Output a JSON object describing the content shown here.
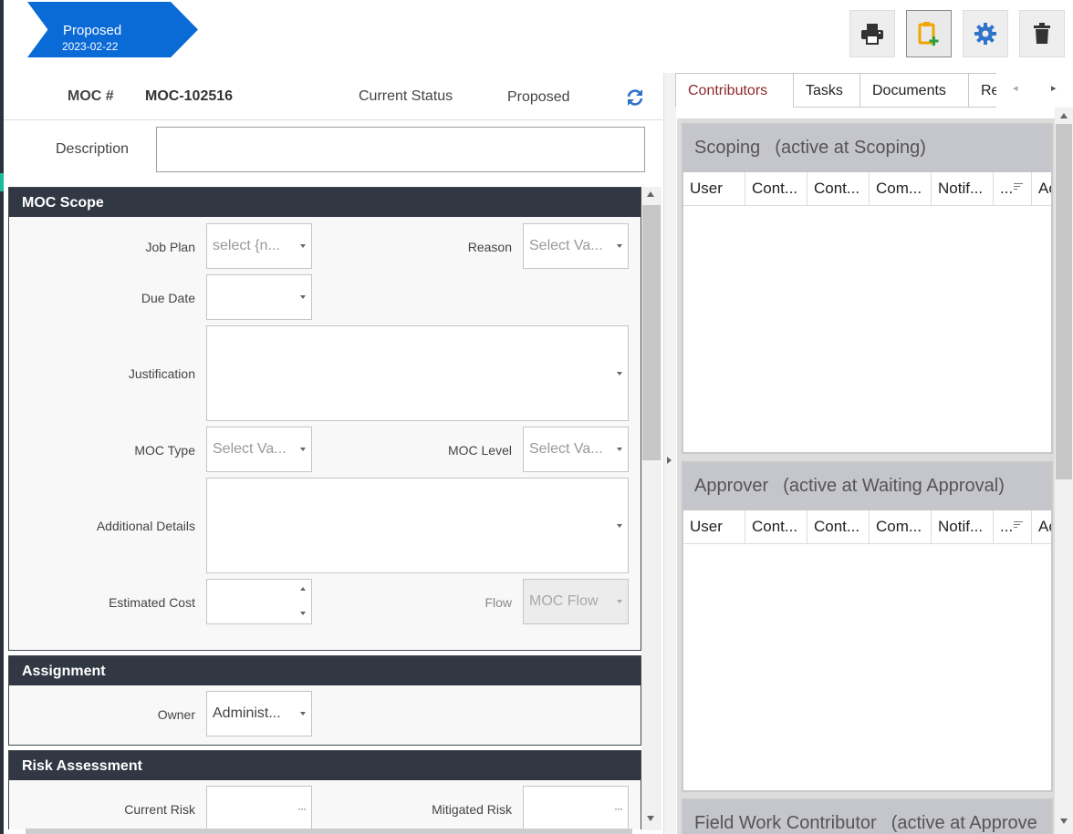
{
  "status_chevron": {
    "state": "Proposed",
    "date": "2023-02-22"
  },
  "toolbar": {
    "print_icon": "printer-icon",
    "add_icon": "clipboard-add-icon",
    "settings_icon": "gear-icon",
    "delete_icon": "trash-icon",
    "colors": {
      "add_icon": "#f0a500",
      "plus": "#2e9e3e",
      "gear": "#2f74c9",
      "dark_icon": "#333333"
    }
  },
  "header": {
    "moc_label": "MOC #",
    "moc_number": "MOC-102516",
    "status_label": "Current Status",
    "status_value": "Proposed",
    "refresh_icon": "refresh-icon"
  },
  "description": {
    "label": "Description",
    "value": ""
  },
  "sections": {
    "scope": {
      "title": "MOC Scope",
      "job_plan": {
        "label": "Job Plan",
        "value": "select {n..."
      },
      "reason": {
        "label": "Reason",
        "value": "Select Va..."
      },
      "due_date": {
        "label": "Due Date",
        "value": ""
      },
      "justification": {
        "label": "Justification",
        "value": ""
      },
      "moc_type": {
        "label": "MOC Type",
        "value": "Select Va..."
      },
      "moc_level": {
        "label": "MOC Level",
        "value": "Select Va..."
      },
      "additional_details": {
        "label": "Additional Details",
        "value": ""
      },
      "estimated_cost": {
        "label": "Estimated Cost",
        "value": ""
      },
      "flow": {
        "label": "Flow",
        "value": "MOC Flow"
      }
    },
    "assignment": {
      "title": "Assignment",
      "owner": {
        "label": "Owner",
        "value": "Administ..."
      }
    },
    "risk": {
      "title": "Risk Assessment",
      "current_risk": {
        "label": "Current Risk",
        "value": "",
        "button": "···"
      },
      "mitigated_risk": {
        "label": "Mitigated Risk",
        "value": "",
        "button": "···"
      }
    }
  },
  "right_panel": {
    "tabs": [
      {
        "label": "Contributors",
        "active": true
      },
      {
        "label": "Tasks",
        "active": false
      },
      {
        "label": "Documents",
        "active": false
      },
      {
        "label": "Re",
        "active": false
      }
    ],
    "nav": {
      "prev": "◂",
      "next": "▸"
    },
    "groups": [
      {
        "title": "Scoping",
        "activity": "(active at Scoping)"
      },
      {
        "title": "Approver",
        "activity": "(active at Waiting Approval)"
      },
      {
        "title": "Field Work Contributor",
        "activity": "(active at Approve"
      }
    ],
    "columns": [
      "User",
      "Cont...",
      "Cont...",
      "Com...",
      "Notif...",
      "...",
      "Ac"
    ]
  }
}
